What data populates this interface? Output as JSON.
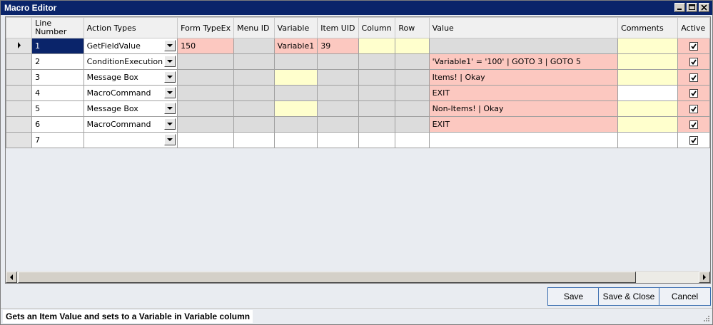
{
  "window": {
    "title": "Macro Editor"
  },
  "columns": [
    {
      "key": "line",
      "label": "Line\nNumber"
    },
    {
      "key": "action",
      "label": "Action Types"
    },
    {
      "key": "formtype",
      "label": "Form TypeEx"
    },
    {
      "key": "menuid",
      "label": "Menu ID"
    },
    {
      "key": "variable",
      "label": "Variable"
    },
    {
      "key": "itemuid",
      "label": "Item UID"
    },
    {
      "key": "column",
      "label": "Column"
    },
    {
      "key": "row",
      "label": "Row"
    },
    {
      "key": "value",
      "label": "Value"
    },
    {
      "key": "comments",
      "label": "Comments"
    },
    {
      "key": "active",
      "label": "Active"
    }
  ],
  "rows": [
    {
      "line": "1",
      "action": "GetFieldValue",
      "formtype": "150",
      "menuid": "",
      "variable": "Variable1",
      "itemuid": "39",
      "column": "",
      "row": "",
      "value": "",
      "comments": "",
      "active": true
    },
    {
      "line": "2",
      "action": "ConditionExecution",
      "formtype": "",
      "menuid": "",
      "variable": "",
      "itemuid": "",
      "column": "",
      "row": "",
      "value": "'Variable1' = '100' | GOTO 3 | GOTO 5",
      "comments": "",
      "active": true
    },
    {
      "line": "3",
      "action": "Message Box",
      "formtype": "",
      "menuid": "",
      "variable": "",
      "itemuid": "",
      "column": "",
      "row": "",
      "value": "Items! | Okay",
      "comments": "",
      "active": true
    },
    {
      "line": "4",
      "action": "MacroCommand",
      "formtype": "",
      "menuid": "",
      "variable": "",
      "itemuid": "",
      "column": "",
      "row": "",
      "value": "EXIT",
      "comments": "",
      "active": true
    },
    {
      "line": "5",
      "action": "Message Box",
      "formtype": "",
      "menuid": "",
      "variable": "",
      "itemuid": "",
      "column": "",
      "row": "",
      "value": "Non-Items! | Okay",
      "comments": "",
      "active": true
    },
    {
      "line": "6",
      "action": "MacroCommand",
      "formtype": "",
      "menuid": "",
      "variable": "",
      "itemuid": "",
      "column": "",
      "row": "",
      "value": "EXIT",
      "comments": "",
      "active": true
    },
    {
      "line": "7",
      "action": "",
      "formtype": "",
      "menuid": "",
      "variable": "",
      "itemuid": "",
      "column": "",
      "row": "",
      "value": "",
      "comments": "",
      "active": true
    }
  ],
  "cell_colors": {
    "white": "#ffffff",
    "grey": "#dcdcdc",
    "pink": "#fcc8c0",
    "yellow": "#ffffcd",
    "selected": "#0a246a"
  },
  "buttons": {
    "save": "Save",
    "save_close": "Save & Close",
    "cancel": "Cancel"
  },
  "status": {
    "message": "Gets an Item Value and sets to a Variable in Variable column"
  }
}
